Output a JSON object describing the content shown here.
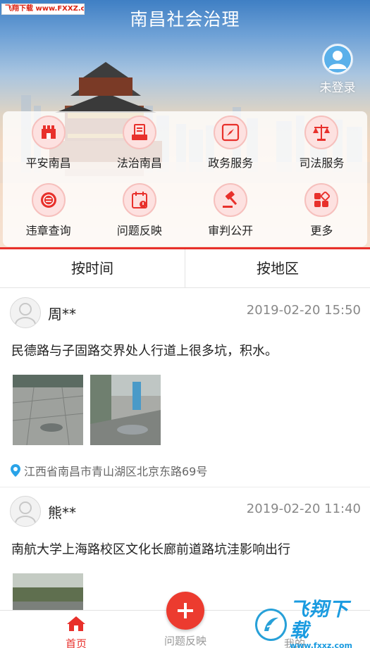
{
  "watermark": "飞翔下载 www.FXXZ.com",
  "header": {
    "title": "南昌社会治理",
    "login_label": "未登录"
  },
  "services": [
    {
      "label": "平安南昌",
      "icon": "castle-gate-icon"
    },
    {
      "label": "法治南昌",
      "icon": "document-tray-icon"
    },
    {
      "label": "政务服务",
      "icon": "compass-icon"
    },
    {
      "label": "司法服务",
      "icon": "scales-icon"
    },
    {
      "label": "违章查询",
      "icon": "traffic-violation-icon"
    },
    {
      "label": "问题反映",
      "icon": "calendar-report-icon"
    },
    {
      "label": "审判公开",
      "icon": "gavel-icon"
    },
    {
      "label": "更多",
      "icon": "apps-grid-icon"
    }
  ],
  "tabs": [
    {
      "label": "按时间"
    },
    {
      "label": "按地区"
    }
  ],
  "posts": [
    {
      "user": "周**",
      "time": "2019-02-20 15:50",
      "text": "民德路与子固路交界处人行道上很多坑，积水。",
      "location": "江西省南昌市青山湖区北京东路69号"
    },
    {
      "user": "熊**",
      "time": "2019-02-20 11:40",
      "text": "南航大学上海路校区文化长廊前道路坑洼影响出行"
    }
  ],
  "bottom_nav": {
    "home": "首页",
    "report": "问题反映",
    "mine": "我的"
  },
  "site_logo": {
    "cn": "飞翔下载",
    "en": "www.fxxz.com"
  },
  "colors": {
    "accent": "#e8302b",
    "icon_bg": "#fde1e0",
    "banner_top": "#3f7fc4"
  }
}
